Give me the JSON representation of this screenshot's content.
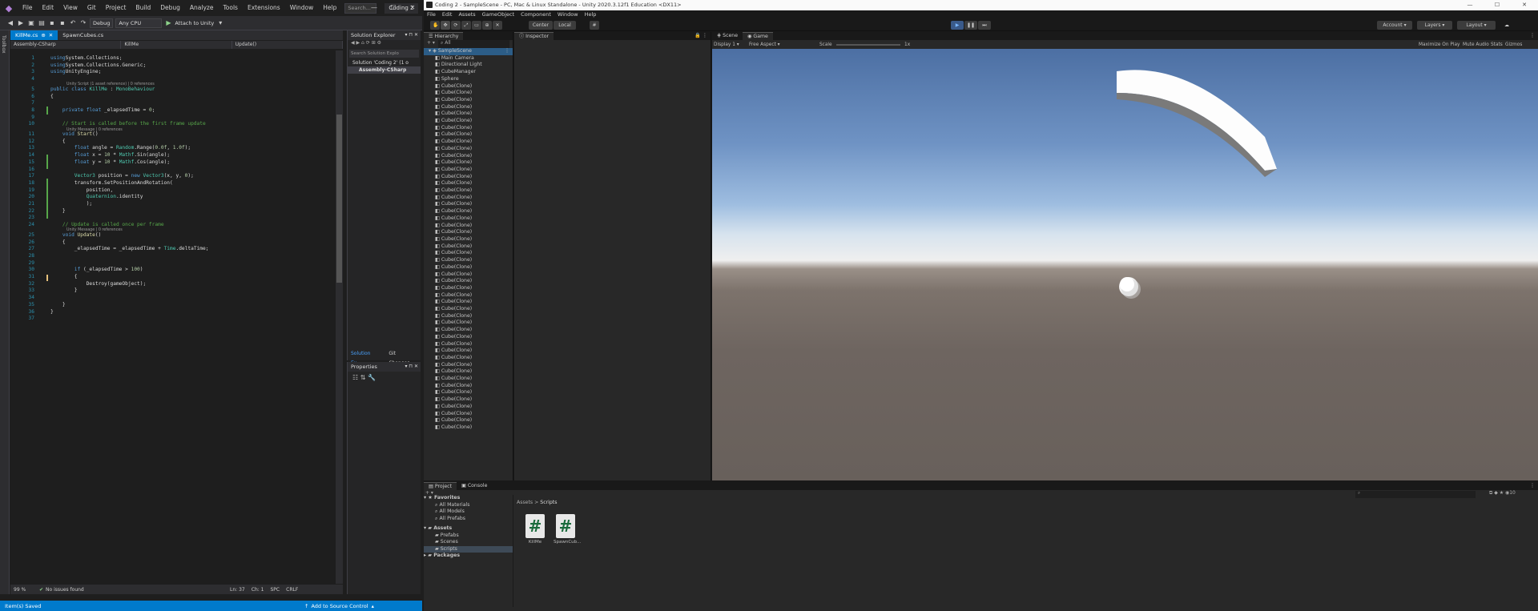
{
  "vs": {
    "menu": [
      "File",
      "Edit",
      "View",
      "Git",
      "Project",
      "Build",
      "Debug",
      "Analyze",
      "Tools",
      "Extensions",
      "Window",
      "Help"
    ],
    "search_placeholder": "Search...",
    "solution_name": "Coding 2",
    "toolbar": {
      "config": "Debug",
      "platform": "Any CPU",
      "attach": "Attach to Unity"
    },
    "left_strip": "Toolbox",
    "tabs": [
      {
        "label": "KillMe.cs",
        "active": true
      },
      {
        "label": "SpawnCubes.cs",
        "active": false
      }
    ],
    "nav": [
      "Assembly-CSharp",
      "KillMe",
      "Update()"
    ],
    "status": {
      "zoom": "99 %",
      "issues": "No issues found",
      "ln": "Ln: 37",
      "ch": "Ch: 1",
      "spc": "SPC",
      "crlf": "CRLF"
    },
    "bottom": {
      "left": "Item(s) Saved",
      "right": "Add to Source Control"
    },
    "solution_explorer": {
      "title": "Solution Explorer",
      "search": "Search Solution Explo",
      "items": [
        "Solution 'Coding 2' (1 o",
        "Assembly-CSharp"
      ],
      "tabs": [
        "Solution Ex...",
        "Git Changes"
      ]
    },
    "properties_title": "Properties",
    "code_lines": [
      {
        "n": "1",
        "t": [
          [
            "kw",
            "using"
          ],
          [
            "",
            "System.Collections;"
          ]
        ]
      },
      {
        "n": "2",
        "t": [
          [
            "kw",
            "using"
          ],
          [
            "",
            "System.Collections.Generic;"
          ]
        ]
      },
      {
        "n": "3",
        "t": [
          [
            "kw",
            "using"
          ],
          [
            "",
            "UnityEngine;"
          ]
        ]
      },
      {
        "n": "4",
        "t": []
      },
      {
        "n": "5",
        "t": [
          [
            "kw",
            "public class "
          ],
          [
            "ty",
            "KillMe"
          ],
          [
            "",
            " : "
          ],
          [
            "ty",
            "MonoBehaviour"
          ]
        ]
      },
      {
        "n": "6",
        "t": [
          [
            "",
            "{"
          ]
        ]
      },
      {
        "n": "7",
        "t": []
      },
      {
        "n": "8",
        "t": [
          [
            "kw",
            "    private float "
          ],
          [
            "",
            "_elapsedTime = "
          ],
          [
            "nm",
            "0"
          ],
          [
            "",
            ";"
          ]
        ]
      },
      {
        "n": "9",
        "t": []
      },
      {
        "n": "10",
        "t": [
          [
            "cm",
            "    // Start is called before the first frame update"
          ]
        ]
      },
      {
        "n": "11",
        "t": [
          [
            "kw",
            "    void "
          ],
          [
            "mt",
            "Start"
          ],
          [
            "",
            "()"
          ]
        ]
      },
      {
        "n": "12",
        "t": [
          [
            "",
            "    {"
          ]
        ]
      },
      {
        "n": "13",
        "t": [
          [
            "kw",
            "        float "
          ],
          [
            "",
            "angle = "
          ],
          [
            "ty",
            "Random"
          ],
          [
            "",
            ".Range("
          ],
          [
            "nm",
            "0.0f"
          ],
          [
            "",
            ", "
          ],
          [
            "nm",
            "1.0f"
          ],
          [
            "",
            ");"
          ]
        ]
      },
      {
        "n": "14",
        "t": [
          [
            "kw",
            "        float "
          ],
          [
            "",
            "x = "
          ],
          [
            "nm",
            "10"
          ],
          [
            "",
            " * "
          ],
          [
            "ty",
            "Mathf"
          ],
          [
            "",
            ".Sin(angle);"
          ]
        ]
      },
      {
        "n": "15",
        "t": [
          [
            "kw",
            "        float "
          ],
          [
            "",
            "y = "
          ],
          [
            "nm",
            "10"
          ],
          [
            "",
            " * "
          ],
          [
            "ty",
            "Mathf"
          ],
          [
            "",
            ".Cos(angle);"
          ]
        ]
      },
      {
        "n": "16",
        "t": []
      },
      {
        "n": "17",
        "t": [
          [
            "ty",
            "        Vector3 "
          ],
          [
            "",
            "position = "
          ],
          [
            "kw",
            "new "
          ],
          [
            "ty",
            "Vector3"
          ],
          [
            "",
            "(x, y, "
          ],
          [
            "nm",
            "0"
          ],
          [
            "",
            ");"
          ]
        ]
      },
      {
        "n": "18",
        "t": [
          [
            "",
            "        transform.SetPositionAndRotation("
          ]
        ]
      },
      {
        "n": "19",
        "t": [
          [
            "",
            "            position,"
          ]
        ]
      },
      {
        "n": "20",
        "t": [
          [
            "ty",
            "            Quaternion"
          ],
          [
            "",
            ".identity"
          ]
        ]
      },
      {
        "n": "21",
        "t": [
          [
            "",
            "            );"
          ]
        ]
      },
      {
        "n": "22",
        "t": [
          [
            "",
            "    }"
          ]
        ]
      },
      {
        "n": "23",
        "t": []
      },
      {
        "n": "24",
        "t": [
          [
            "cm",
            "    // Update is called once per frame"
          ]
        ]
      },
      {
        "n": "25",
        "t": [
          [
            "kw",
            "    void "
          ],
          [
            "mt",
            "Update"
          ],
          [
            "",
            "()"
          ]
        ]
      },
      {
        "n": "26",
        "t": [
          [
            "",
            "    {"
          ]
        ]
      },
      {
        "n": "27",
        "t": [
          [
            "",
            "        _elapsedTime = _elapsedTime + "
          ],
          [
            "ty",
            "Time"
          ],
          [
            "",
            ".deltaTime;"
          ]
        ]
      },
      {
        "n": "28",
        "t": []
      },
      {
        "n": "29",
        "t": []
      },
      {
        "n": "30",
        "t": [
          [
            "kw",
            "        if "
          ],
          [
            "",
            "(_elapsedTime > "
          ],
          [
            "nm",
            "100"
          ],
          [
            "",
            ")"
          ]
        ]
      },
      {
        "n": "31",
        "t": [
          [
            "",
            "        {"
          ]
        ]
      },
      {
        "n": "32",
        "t": [
          [
            "",
            "            Destroy(gameObject);"
          ]
        ]
      },
      {
        "n": "33",
        "t": [
          [
            "",
            "        }"
          ]
        ]
      },
      {
        "n": "34",
        "t": []
      },
      {
        "n": "35",
        "t": [
          [
            "",
            "    }"
          ]
        ]
      },
      {
        "n": "36",
        "t": [
          [
            "",
            "}"
          ]
        ]
      },
      {
        "n": "37",
        "t": []
      }
    ],
    "codelens": [
      "Unity Script (1 asset reference) | 0 references",
      "Unity Message | 0 references",
      "Unity Message | 0 references"
    ]
  },
  "unity": {
    "title": "Coding 2 - SampleScene - PC, Mac & Linux Standalone - Unity 2020.3.12f1 Education <DX11>",
    "menu": [
      "File",
      "Edit",
      "Assets",
      "GameObject",
      "Component",
      "Window",
      "Help"
    ],
    "toolbar": {
      "center": "Center",
      "local": "Local",
      "account": "Account",
      "layers": "Layers",
      "layout": "Layout"
    },
    "hierarchy": {
      "tab": "Hierarchy",
      "search": "All",
      "scene": "SampleScene",
      "items": [
        "Main Camera",
        "Directional Light",
        "CubeManager",
        "Sphere"
      ],
      "clone_label": "Cube(Clone)",
      "clone_count": 50
    },
    "inspector_tab": "Inspector",
    "game": {
      "tabs": [
        "Scene",
        "Game"
      ],
      "display": "Display 1",
      "aspect": "Free Aspect",
      "scale_label": "Scale",
      "scale_value": "1x",
      "options": [
        "Maximize On Play",
        "Mute Audio",
        "Stats",
        "Gizmos"
      ]
    },
    "project": {
      "tabs": [
        "Project",
        "Console"
      ],
      "favorites_title": "Favorites",
      "favorites": [
        "All Materials",
        "All Models",
        "All Prefabs"
      ],
      "assets_title": "Assets",
      "assets": [
        "Prefabs",
        "Scenes",
        "Scripts"
      ],
      "packages": "Packages",
      "breadcrumb": [
        "Assets",
        "Scripts"
      ],
      "files": [
        "KillMe",
        "SpawnCub..."
      ],
      "count": "10"
    }
  }
}
